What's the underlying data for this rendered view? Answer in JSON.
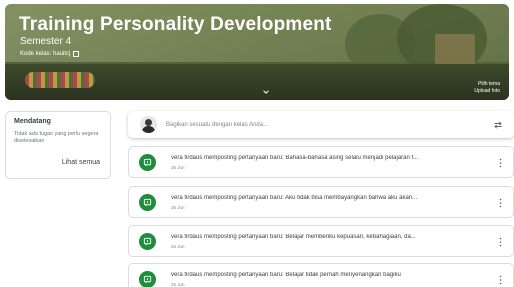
{
  "banner": {
    "title": "Training Personality Development",
    "section": "Semester 4",
    "class_code": "Kode kelas: hauitcj",
    "select_theme": "Pilih tema",
    "upload_photo": "Upload foto"
  },
  "upcoming": {
    "title": "Mendatang",
    "empty_text": "Tidak ada tugas yang perlu segera diselesaikan",
    "view_all": "Lihat semua"
  },
  "announce": {
    "placeholder": "Bagikan sesuatu dengan kelas Anda..."
  },
  "posts": [
    {
      "text": "vera firdaus memposting pertanyaan baru: Bahasa-bahasa asing selalu menjadi pelajaran f...",
      "date": "25 Jun"
    },
    {
      "text": "vera firdaus memposting pertanyaan baru: Aku tidak bisa membayangkan bahwa aku akan...",
      "date": "25 Jun"
    },
    {
      "text": "vera firdaus memposting pertanyaan baru: Belajar memberiku kepuasan, kebahagiaan, da...",
      "date": "25 Jun"
    },
    {
      "text": "vera firdaus memposting pertanyaan baru: Belajar tidak pernah menyenangkan bagiku",
      "date": "25 Jun"
    }
  ],
  "colors": {
    "assignment_green": "#1e8e3e",
    "banner_green": "#5c6b44"
  },
  "icons": {
    "post": "question-icon",
    "more": "more-vert-icon",
    "repost": "repost-icon",
    "expand": "chevron-down-icon",
    "fullscreen": "fullscreen-icon"
  }
}
